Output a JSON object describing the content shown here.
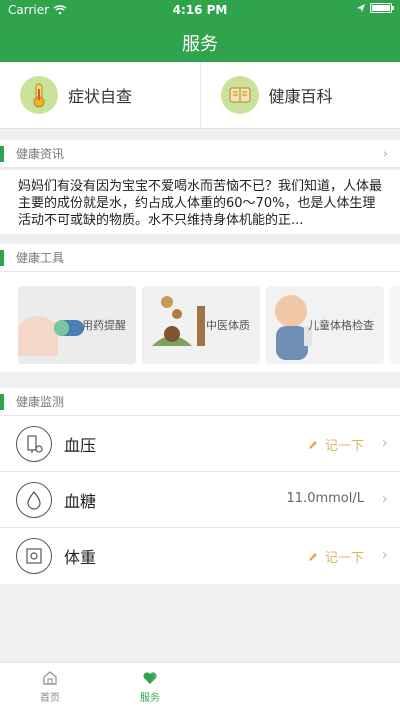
{
  "status": {
    "carrier": "Carrier",
    "time": "4:16 PM"
  },
  "nav": {
    "title": "服务"
  },
  "top_actions": [
    {
      "label": "症状自查",
      "icon": "thermometer-icon"
    },
    {
      "label": "健康百科",
      "icon": "book-icon"
    }
  ],
  "sections": {
    "news_title": "健康资讯",
    "tools_title": "健康工具",
    "monitor_title": "健康监测"
  },
  "news": {
    "text": "妈妈们有没有因为宝宝不爱喝水而苦恼不已？我们知道，人体最主要的成份就是水，约占成人体重的60～70%，也是人体生理活动不可或缺的物质。水不只维持身体机能的正..."
  },
  "tools": [
    {
      "label": "用药提醒"
    },
    {
      "label": "中医体质"
    },
    {
      "label": "儿童体格检查"
    }
  ],
  "monitor": [
    {
      "label": "血压",
      "right_text": "记一下",
      "right_type": "record",
      "icon": "blood-pressure-icon"
    },
    {
      "label": "血糖",
      "right_text": "11.0mmol/L",
      "right_type": "value",
      "icon": "drop-icon"
    },
    {
      "label": "体重",
      "right_text": "记一下",
      "right_type": "record",
      "icon": "scale-icon"
    }
  ],
  "tabs": [
    {
      "label": "首页",
      "icon": "home-icon"
    },
    {
      "label": "服务",
      "icon": "heart-icon"
    }
  ],
  "colors": {
    "brand": "#2fa44c",
    "record": "#d8b55a"
  }
}
